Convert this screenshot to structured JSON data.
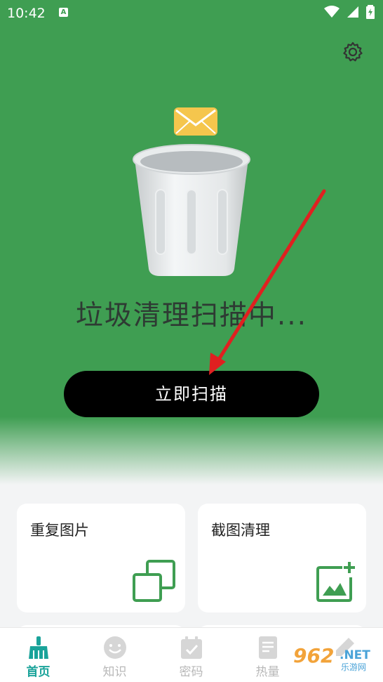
{
  "status_bar": {
    "time": "10:42",
    "notif_icon": "A"
  },
  "hero": {
    "settings_icon": "gear-icon",
    "status_text": "垃圾清理扫描中...",
    "scan_button_label": "立即扫描"
  },
  "cards": [
    {
      "label": "重复图片",
      "icon": "duplicate-icon"
    },
    {
      "label": "截图清理",
      "icon": "add-image-icon"
    }
  ],
  "tabs": [
    {
      "label": "首页",
      "icon": "broom-icon",
      "active": true
    },
    {
      "label": "知识",
      "icon": "smile-icon"
    },
    {
      "label": "密码",
      "icon": "calendar-check-icon"
    },
    {
      "label": "热量",
      "icon": "document-icon"
    }
  ],
  "watermark": {
    "main": "962",
    "net": ".NET",
    "sub": "乐游网"
  },
  "colors": {
    "accent": "#3f9e52",
    "tab_active": "#1aa39a",
    "arrow": "#e02020"
  }
}
